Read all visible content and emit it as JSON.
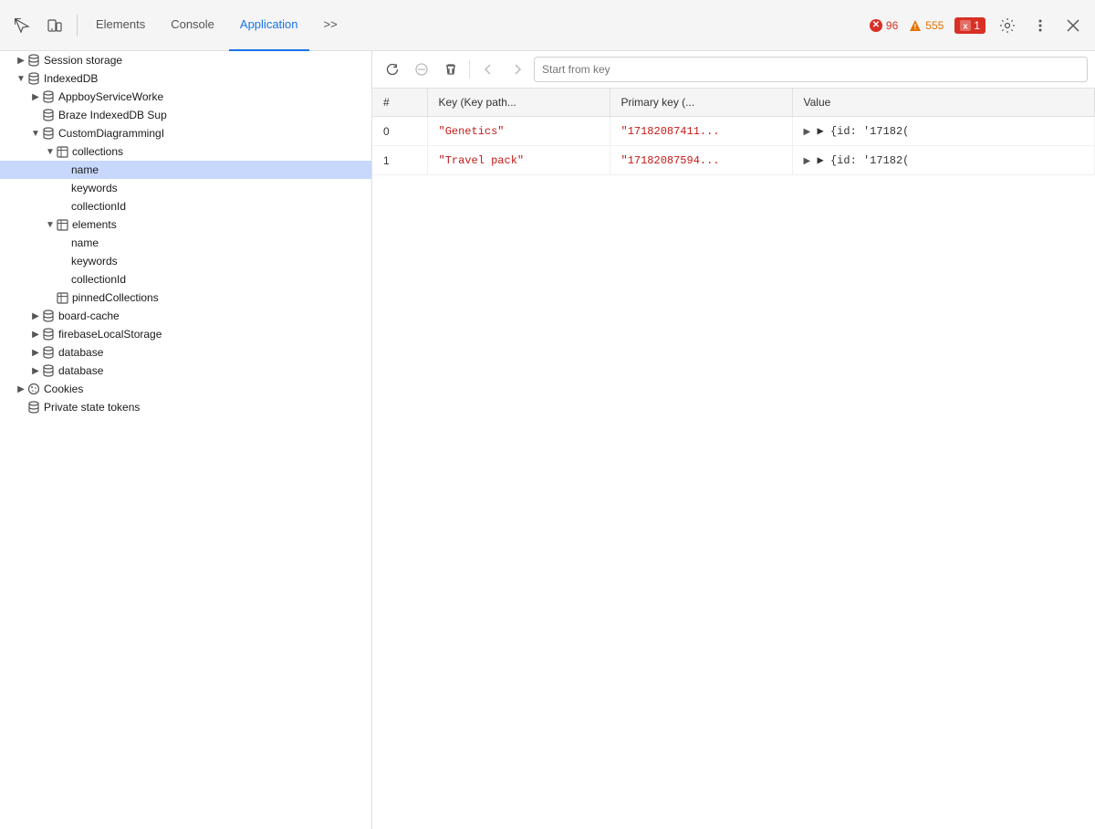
{
  "toolbar": {
    "tabs": [
      {
        "id": "elements",
        "label": "Elements",
        "active": false
      },
      {
        "id": "console",
        "label": "Console",
        "active": false
      },
      {
        "id": "application",
        "label": "Application",
        "active": true
      },
      {
        "id": "more",
        "label": ">>",
        "active": false
      }
    ],
    "badges": {
      "error_count": "96",
      "warning_count": "555",
      "info_count": "1"
    }
  },
  "secondary_toolbar": {
    "refresh_title": "Refresh",
    "clear_title": "Clear",
    "delete_title": "Delete",
    "prev_title": "Previous",
    "next_title": "Next",
    "key_placeholder": "Start from key"
  },
  "sidebar": {
    "items": [
      {
        "id": "session-storage",
        "label": "Session storage",
        "indent": 1,
        "icon": "db",
        "expandable": false,
        "expanded": false
      },
      {
        "id": "indexed-db",
        "label": "IndexedDB",
        "indent": 1,
        "icon": "db",
        "expandable": true,
        "expanded": true
      },
      {
        "id": "appboy",
        "label": "AppboyServiceWorke",
        "indent": 2,
        "icon": "db",
        "expandable": true,
        "expanded": false
      },
      {
        "id": "braze",
        "label": "Braze IndexedDB Sup",
        "indent": 2,
        "icon": "db",
        "expandable": false,
        "expanded": false
      },
      {
        "id": "custom-diagramming",
        "label": "CustomDiagrammingI",
        "indent": 2,
        "icon": "db",
        "expandable": true,
        "expanded": true
      },
      {
        "id": "collections",
        "label": "collections",
        "indent": 3,
        "icon": "table",
        "expandable": true,
        "expanded": true
      },
      {
        "id": "name",
        "label": "name",
        "indent": 4,
        "icon": null,
        "expandable": false,
        "expanded": false,
        "selected": true
      },
      {
        "id": "keywords",
        "label": "keywords",
        "indent": 4,
        "icon": null,
        "expandable": false,
        "expanded": false
      },
      {
        "id": "collectionId",
        "label": "collectionId",
        "indent": 4,
        "icon": null,
        "expandable": false,
        "expanded": false
      },
      {
        "id": "elements",
        "label": "elements",
        "indent": 3,
        "icon": "table",
        "expandable": true,
        "expanded": true
      },
      {
        "id": "elements-name",
        "label": "name",
        "indent": 4,
        "icon": null,
        "expandable": false,
        "expanded": false
      },
      {
        "id": "elements-keywords",
        "label": "keywords",
        "indent": 4,
        "icon": null,
        "expandable": false,
        "expanded": false
      },
      {
        "id": "elements-collectionId",
        "label": "collectionId",
        "indent": 4,
        "icon": null,
        "expandable": false,
        "expanded": false
      },
      {
        "id": "pinned-collections",
        "label": "pinnedCollections",
        "indent": 3,
        "icon": "table",
        "expandable": false,
        "expanded": false
      },
      {
        "id": "board-cache",
        "label": "board-cache",
        "indent": 2,
        "icon": "db",
        "expandable": true,
        "expanded": false
      },
      {
        "id": "firebase-local-storage",
        "label": "firebaseLocalStorage",
        "indent": 2,
        "icon": "db",
        "expandable": true,
        "expanded": false
      },
      {
        "id": "database-1",
        "label": "database",
        "indent": 2,
        "icon": "db",
        "expandable": true,
        "expanded": false
      },
      {
        "id": "database-2",
        "label": "database",
        "indent": 2,
        "icon": "db",
        "expandable": true,
        "expanded": false
      },
      {
        "id": "cookies",
        "label": "Cookies",
        "indent": 1,
        "icon": "cookie",
        "expandable": true,
        "expanded": false
      },
      {
        "id": "private-state-tokens",
        "label": "Private state tokens",
        "indent": 1,
        "icon": "db",
        "expandable": false,
        "expanded": false
      }
    ]
  },
  "table": {
    "columns": [
      "#",
      "Key (Key path...",
      "Primary key (...",
      "Value"
    ],
    "rows": [
      {
        "num": "0",
        "key": "\"Genetics\"",
        "primary_key": "\"17182087411...",
        "value": "▶ {id: '17182(",
        "key_class": "string-val",
        "primary_class": "string-val",
        "value_class": "object-val"
      },
      {
        "num": "1",
        "key": "\"Travel pack\"",
        "primary_key": "\"17182087594...",
        "value": "▶ {id: '17182(",
        "key_class": "string-val",
        "primary_class": "string-val",
        "value_class": "object-val"
      }
    ]
  }
}
